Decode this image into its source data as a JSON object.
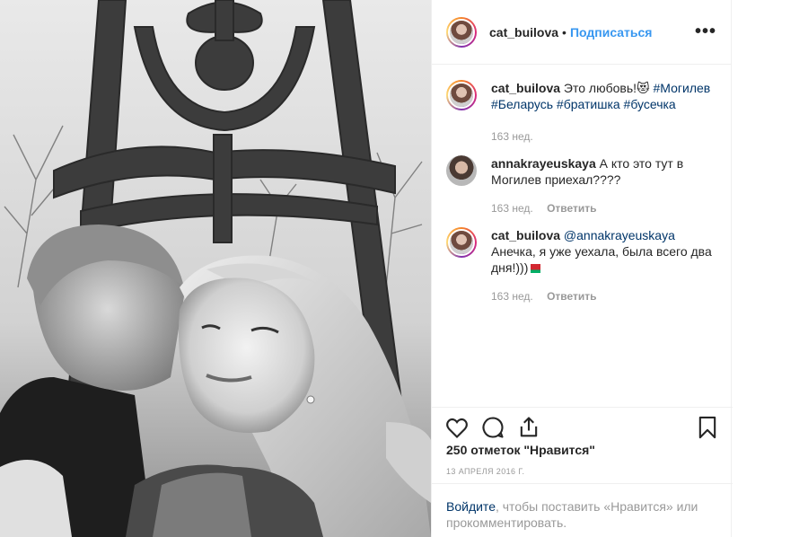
{
  "post": {
    "username": "cat_builova",
    "follow_label": "Подписаться",
    "separator": "•",
    "more_label": "•••"
  },
  "comments": [
    {
      "username": "cat_builova",
      "text_before": " Это любовь!",
      "emoji": "😻",
      "hashtags_line1": " #Могилев",
      "hashtags_line2": "#Беларусь #братишка #бусечка",
      "age": "163 нед.",
      "reply": ""
    },
    {
      "username": "annakrayeuskaya",
      "text": " А кто это тут в Могилев приехал????",
      "age": "163 нед.",
      "reply": "Ответить"
    },
    {
      "username": "cat_builova",
      "mention": " @annakrayeuskaya",
      "text": "Анечка, я уже уехала, была всего два дня!)))",
      "age": "163 нед.",
      "reply": "Ответить"
    }
  ],
  "likes": "250 отметок \"Нравится\"",
  "date": "13 апреля 2016 г.",
  "login": {
    "link": "Войдите",
    "text": ", чтобы поставить «Нравится» или прокомментировать."
  },
  "icons": [
    "heart-icon",
    "comment-icon",
    "share-icon",
    "bookmark-icon",
    "more-options-icon"
  ]
}
